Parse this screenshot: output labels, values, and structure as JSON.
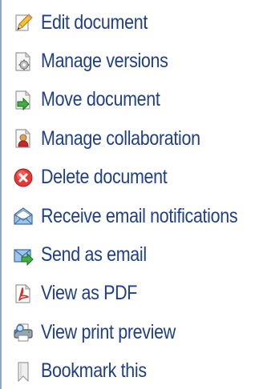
{
  "menu": {
    "items": [
      {
        "label": "Edit document",
        "icon": "pencil-icon"
      },
      {
        "label": "Manage versions",
        "icon": "document-gear-icon"
      },
      {
        "label": "Move document",
        "icon": "document-arrow-icon"
      },
      {
        "label": "Manage collaboration",
        "icon": "document-user-icon"
      },
      {
        "label": "Delete document",
        "icon": "delete-icon"
      },
      {
        "label": "Receive email notifications",
        "icon": "envelope-icon"
      },
      {
        "label": "Send as email",
        "icon": "send-email-icon"
      },
      {
        "label": "View as PDF",
        "icon": "pdf-icon"
      },
      {
        "label": "View print preview",
        "icon": "printer-icon"
      },
      {
        "label": "Bookmark this",
        "icon": "bookmark-icon"
      }
    ]
  },
  "colors": {
    "link_text": "#1f3f86",
    "panel_border": "#8aa8cc"
  }
}
